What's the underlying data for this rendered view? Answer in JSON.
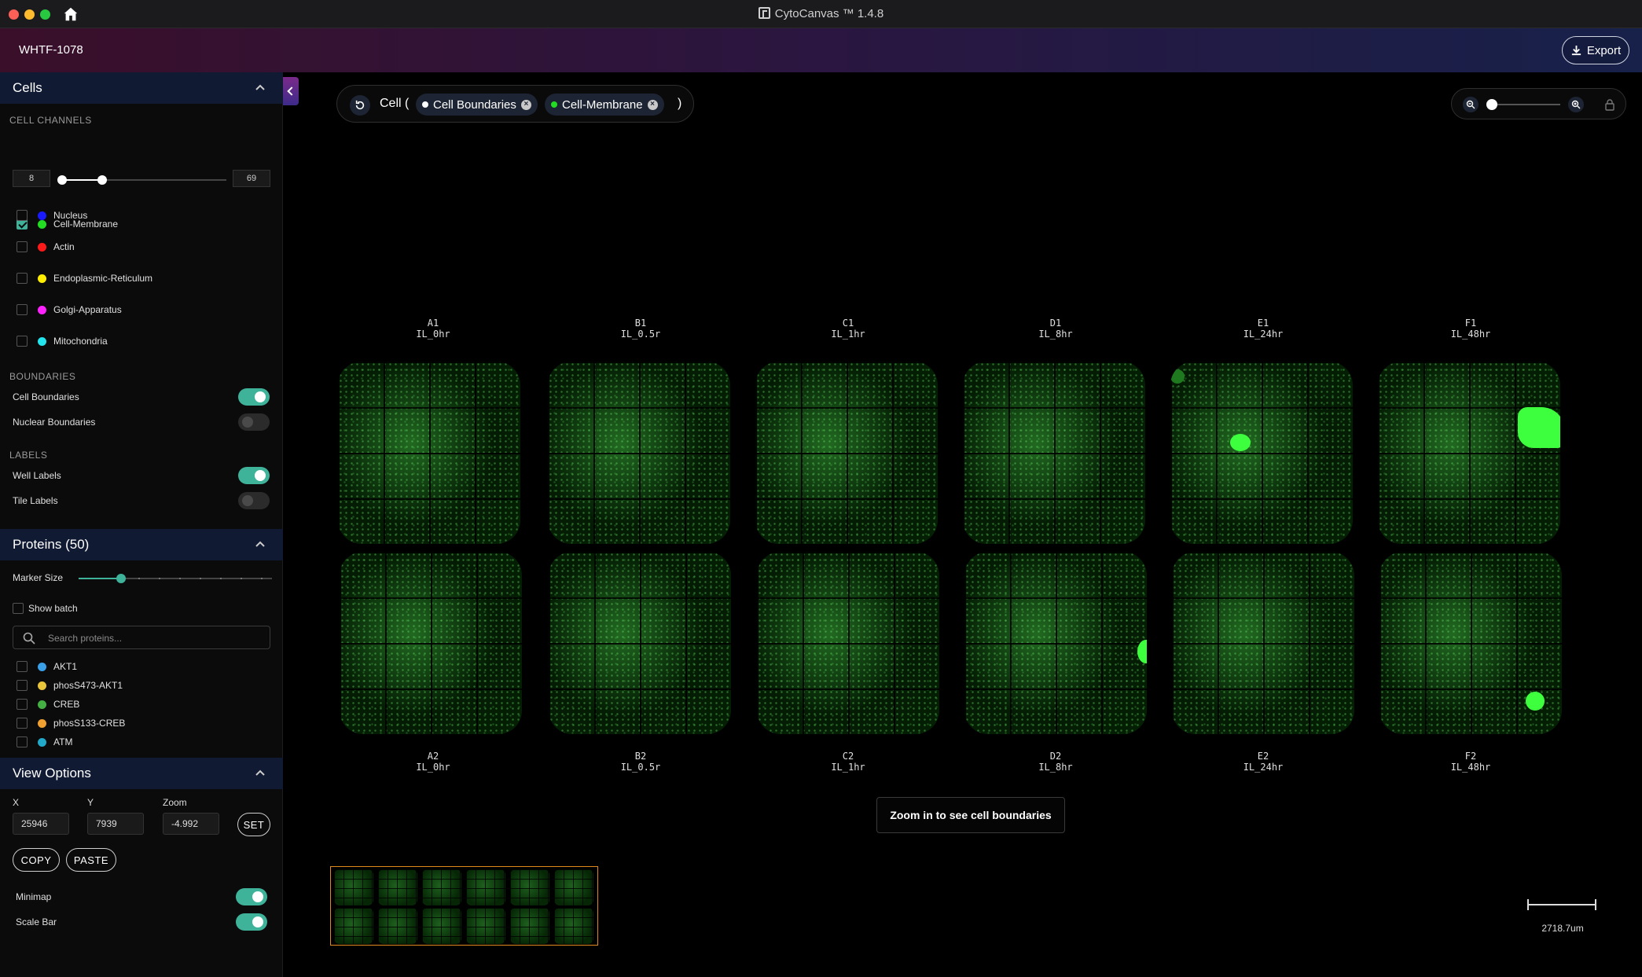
{
  "window": {
    "title": "CytoCanvas ™ 1.4.8"
  },
  "header": {
    "project": "WHTF-1078",
    "export_label": "Export"
  },
  "cells": {
    "title": "Cells",
    "channels_label": "CELL CHANNELS",
    "channels": [
      {
        "name": "Cell-Membrane",
        "color": "#22dd22",
        "checked": true
      },
      {
        "name": "Nucleus",
        "color": "#1a1aff",
        "checked": false
      },
      {
        "name": "Actin",
        "color": "#ff1a1a",
        "checked": false
      },
      {
        "name": "Endoplasmic-Reticulum",
        "color": "#ffee00",
        "checked": false
      },
      {
        "name": "Golgi-Apparatus",
        "color": "#ff22ff",
        "checked": false
      },
      {
        "name": "Mitochondria",
        "color": "#22e5ee",
        "checked": false
      }
    ],
    "range_min": "8",
    "range_max": "69",
    "boundaries_label": "BOUNDARIES",
    "cell_boundaries": "Cell Boundaries",
    "nuclear_boundaries": "Nuclear Boundaries",
    "labels_label": "LABELS",
    "well_labels": "Well Labels",
    "tile_labels": "Tile Labels"
  },
  "proteins": {
    "title": "Proteins (50)",
    "marker_size": "Marker Size",
    "show_batch": "Show batch",
    "search_placeholder": "Search proteins...",
    "items": [
      {
        "name": "AKT1",
        "color": "#3aa0e8"
      },
      {
        "name": "phosS473-AKT1",
        "color": "#e8c53a"
      },
      {
        "name": "CREB",
        "color": "#44b044"
      },
      {
        "name": "phosS133-CREB",
        "color": "#f0a030"
      },
      {
        "name": "ATM",
        "color": "#22a8c8"
      }
    ]
  },
  "view_options": {
    "title": "View Options",
    "x_label": "X",
    "x_value": "25946",
    "y_label": "Y",
    "y_value": "7939",
    "zoom_label": "Zoom",
    "zoom_value": "-4.992",
    "set": "SET",
    "copy": "COPY",
    "paste": "PASTE",
    "minimap": "Minimap",
    "scale_bar": "Scale Bar"
  },
  "filter_bar": {
    "prefix": "Cell (",
    "suffix": ")",
    "chips": [
      {
        "label": "Cell Boundaries",
        "color": "#ffffff"
      },
      {
        "label": "Cell-Membrane",
        "color": "#22dd22"
      }
    ]
  },
  "wells": [
    {
      "id": "A1",
      "label": "IL_0hr"
    },
    {
      "id": "B1",
      "label": "IL_0.5r"
    },
    {
      "id": "C1",
      "label": "IL_1hr"
    },
    {
      "id": "D1",
      "label": "IL_8hr"
    },
    {
      "id": "E1",
      "label": "IL_24hr"
    },
    {
      "id": "F1",
      "label": "IL_48hr"
    },
    {
      "id": "A2",
      "label": "IL_0hr"
    },
    {
      "id": "B2",
      "label": "IL_0.5r"
    },
    {
      "id": "C2",
      "label": "IL_1hr"
    },
    {
      "id": "D2",
      "label": "IL_8hr"
    },
    {
      "id": "E2",
      "label": "IL_24hr"
    },
    {
      "id": "F2",
      "label": "IL_48hr"
    }
  ],
  "zoom_hint": "Zoom in to see cell boundaries",
  "scale_label": "2718.7um"
}
